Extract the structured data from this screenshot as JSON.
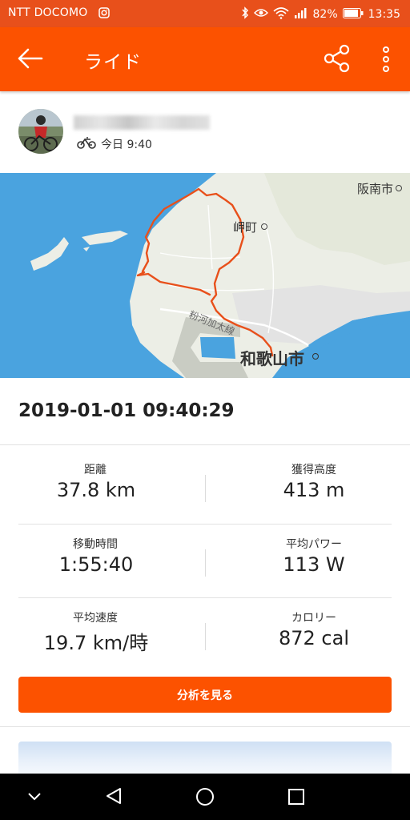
{
  "status_bar": {
    "carrier": "NTT DOCOMO",
    "battery": "82%",
    "time": "13:35"
  },
  "app_bar": {
    "title": "ライド",
    "back_icon": "arrow-left-icon",
    "share_icon": "share-icon",
    "more_icon": "more-vert-icon"
  },
  "activity": {
    "type_icon": "bike-icon",
    "time": "今日 9:40"
  },
  "map": {
    "labels": {
      "hannan": "阪南市",
      "misaki": "岬町",
      "wakayama": "和歌山市",
      "road": "粉河加太線"
    },
    "colors": {
      "sea": "#4aa3df",
      "land": "#eceee6",
      "route": "#e8501b"
    }
  },
  "start_datetime": "2019-01-01 09:40:29",
  "stats": [
    {
      "label": "距離",
      "value": "37.8 km"
    },
    {
      "label": "獲得高度",
      "value": "413 m"
    },
    {
      "label": "移動時間",
      "value": "1:55:40"
    },
    {
      "label": "平均パワー",
      "value": "113 W"
    },
    {
      "label": "平均速度",
      "value": "19.7 km/時"
    },
    {
      "label": "カロリー",
      "value": "872 cal"
    }
  ],
  "analyze_button": "分析を見る",
  "colors": {
    "accent": "#fc5200",
    "status_bar": "#e8501b"
  }
}
